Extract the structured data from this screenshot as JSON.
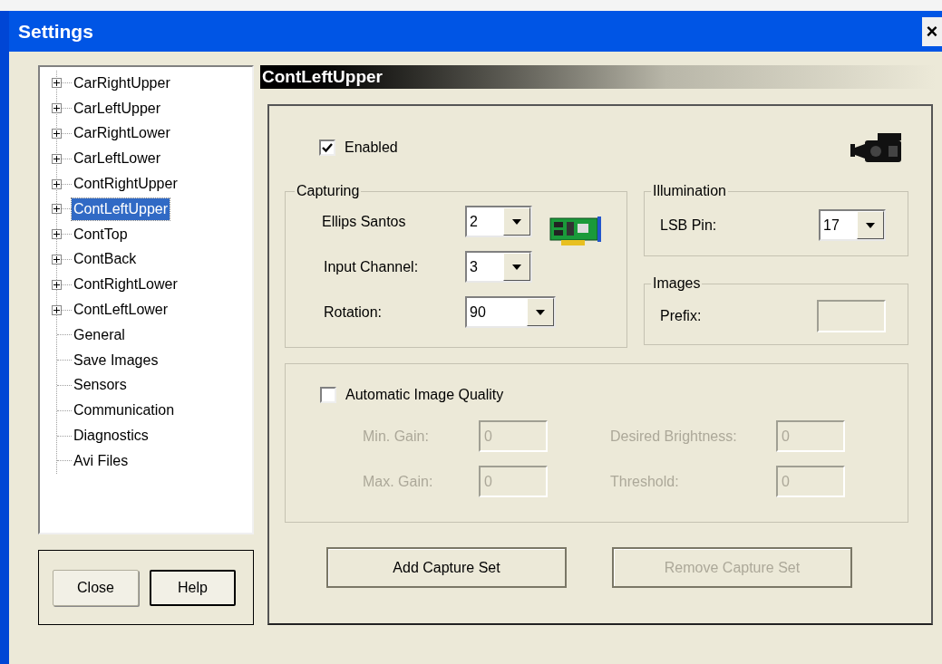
{
  "window": {
    "title": "Settings",
    "close": "×"
  },
  "tree": {
    "items": [
      {
        "label": "CarRightUpper",
        "kind": "group",
        "expanded": false,
        "selected": false
      },
      {
        "label": "CarLeftUpper",
        "kind": "group",
        "expanded": false,
        "selected": false
      },
      {
        "label": "CarRightLower",
        "kind": "group",
        "expanded": false,
        "selected": false
      },
      {
        "label": "CarLeftLower",
        "kind": "group",
        "expanded": false,
        "selected": false
      },
      {
        "label": "ContRightUpper",
        "kind": "group",
        "expanded": false,
        "selected": false
      },
      {
        "label": "ContLeftUpper",
        "kind": "group",
        "expanded": false,
        "selected": true
      },
      {
        "label": "ContTop",
        "kind": "group",
        "expanded": false,
        "selected": false
      },
      {
        "label": "ContBack",
        "kind": "group",
        "expanded": false,
        "selected": false
      },
      {
        "label": "ContRightLower",
        "kind": "group",
        "expanded": false,
        "selected": false
      },
      {
        "label": "ContLeftLower",
        "kind": "group",
        "expanded": false,
        "selected": false
      },
      {
        "label": "General",
        "kind": "leaf",
        "selected": false
      },
      {
        "label": "Save Images",
        "kind": "leaf",
        "selected": false
      },
      {
        "label": "Sensors",
        "kind": "leaf",
        "selected": false
      },
      {
        "label": "Communication",
        "kind": "leaf",
        "selected": false
      },
      {
        "label": "Diagnostics",
        "kind": "leaf",
        "selected": false
      },
      {
        "label": "Avi Files",
        "kind": "leaf",
        "selected": false
      }
    ]
  },
  "footer_buttons": [
    {
      "label": "Close",
      "default": false
    },
    {
      "label": "Help",
      "default": true
    }
  ],
  "page": {
    "title": "ContLeftUpper",
    "enabled": {
      "label": "Enabled",
      "checked": true
    },
    "capturing": {
      "title": "Capturing",
      "fields": [
        {
          "label": "Ellips Santos",
          "value": "2",
          "wide": false
        },
        {
          "label": "Input Channel:",
          "value": "3",
          "wide": false
        },
        {
          "label": "Rotation:",
          "value": "90",
          "wide": true
        }
      ]
    },
    "illumination": {
      "title": "Illumination",
      "fields": [
        {
          "label": "LSB Pin:",
          "value": "17"
        }
      ]
    },
    "images": {
      "title": "Images",
      "prefix": {
        "label": "Prefix:"
      }
    },
    "auto_quality": {
      "label": "Automatic Image Quality",
      "checked": false,
      "fields": [
        {
          "label": "Min. Gain:",
          "value": "0",
          "disabled": true
        },
        {
          "label": "Desired Brightness:",
          "value": "0",
          "disabled": true
        },
        {
          "label": "Max. Gain:",
          "value": "0",
          "disabled": true
        },
        {
          "label": "Threshold:",
          "value": "0",
          "disabled": true
        }
      ]
    },
    "buttons": [
      {
        "label": "Add Capture Set",
        "disabled": false
      },
      {
        "label": "Remove Capture Set",
        "disabled": true
      }
    ]
  }
}
